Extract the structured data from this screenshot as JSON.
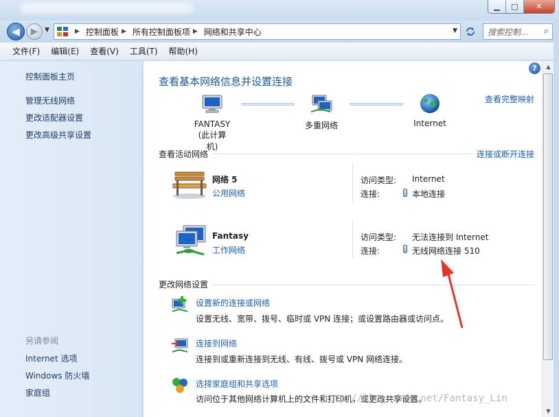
{
  "window": {
    "min_glyph": "▁",
    "max_glyph": "□",
    "close_glyph": "✕"
  },
  "address": {
    "back_glyph": "◀",
    "fwd_glyph": "▶",
    "crumbs": [
      "控制面板",
      "所有控制面板项",
      "网络和共享中心"
    ],
    "search_placeholder": "搜索控制..."
  },
  "menu": [
    "文件(F)",
    "编辑(E)",
    "查看(V)",
    "工具(T)",
    "帮助(H)"
  ],
  "sidebar": {
    "home": "控制面板主页",
    "items": [
      "管理无线网络",
      "更改适配器设置",
      "更改高级共享设置"
    ],
    "see_also_heading": "另请参阅",
    "see_also": [
      "Internet 选项",
      "Windows 防火墙",
      "家庭组"
    ]
  },
  "main": {
    "title": "查看基本网络信息并设置连接",
    "full_map_link": "查看完整映射",
    "map": {
      "computer_name": "FANTASY",
      "computer_sub": "(此计算机)",
      "middle": "多重网络",
      "internet": "Internet"
    },
    "active_heading": "查看活动网络",
    "connect_disconnect_link": "连接或断开连接",
    "networks": [
      {
        "name": "网络  5",
        "type": "公用网络",
        "access_label": "访问类型:",
        "access_value": "Internet",
        "conn_label": "连接:",
        "conn_value": "本地连接",
        "icon": "park-bench-icon"
      },
      {
        "name": "Fantasy",
        "type": "工作网络",
        "access_label": "访问类型:",
        "access_value": "无法连接到 Internet",
        "conn_label": "连接:",
        "conn_value": "无线网络连接 510",
        "icon": "work-network-icon"
      }
    ],
    "change_heading": "更改网络设置",
    "tasks": [
      {
        "link": "设置新的连接或网络",
        "desc": "设置无线、宽带、拨号、临时或 VPN 连接；或设置路由器或访问点。"
      },
      {
        "link": "连接到网络",
        "desc": "连接到或重新连接到无线、有线、拨号或 VPN 网络连接。"
      },
      {
        "link": "选择家庭组和共享选项",
        "desc": "访问位于其他网络计算机上的文件和打印机，或更改共享设置。"
      }
    ]
  },
  "watermark": "http://blog.csdn.net/Fantasy_Lin",
  "colors": {
    "link": "#1a5fb4",
    "title": "#1d5a96",
    "arrow": "#e8332a"
  }
}
